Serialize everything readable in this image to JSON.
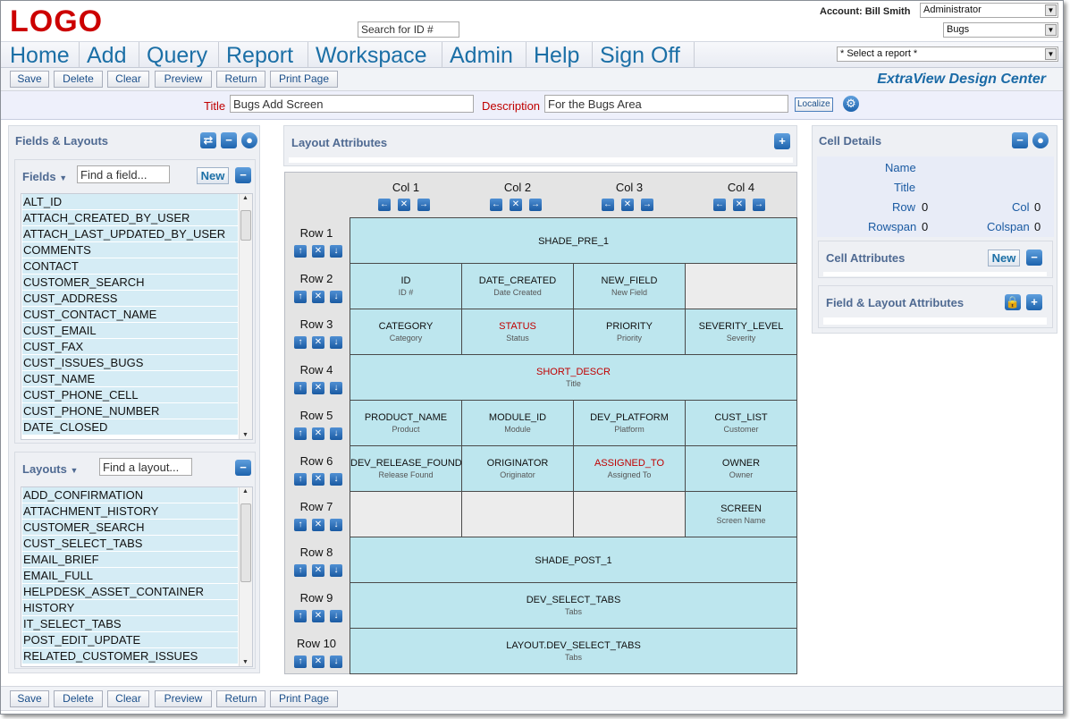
{
  "header": {
    "logo": "LOGO",
    "search_placeholder": "Search for ID #",
    "account_label": "Account: Bill Smith",
    "role_select": "Administrator",
    "area_select": "Bugs",
    "report_select": "* Select a report *"
  },
  "nav": [
    "Home",
    "Add",
    "Query",
    "Report",
    "Workspace",
    "Admin",
    "Help",
    "Sign Off"
  ],
  "toolbar": {
    "buttons": [
      "Save",
      "Delete",
      "Clear",
      "Preview",
      "Return",
      "Print Page"
    ],
    "design_center": "ExtraView Design Center"
  },
  "titlerow": {
    "title_label": "Title",
    "title_value": "Bugs Add Screen",
    "description_label": "Description",
    "description_value": "For the Bugs Area",
    "localize_label": "Localize"
  },
  "fields_layouts": {
    "title": "Fields & Layouts",
    "fields_label": "Fields",
    "fields_search_placeholder": "Find a field...",
    "new_label": "New",
    "fields": [
      "ALT_ID",
      "ATTACH_CREATED_BY_USER",
      "ATTACH_LAST_UPDATED_BY_USER",
      "COMMENTS",
      "CONTACT",
      "CUSTOMER_SEARCH",
      "CUST_ADDRESS",
      "CUST_CONTACT_NAME",
      "CUST_EMAIL",
      "CUST_FAX",
      "CUST_ISSUES_BUGS",
      "CUST_NAME",
      "CUST_PHONE_CELL",
      "CUST_PHONE_NUMBER",
      "DATE_CLOSED"
    ],
    "layouts_label": "Layouts",
    "layouts_search_placeholder": "Find a layout...",
    "layouts": [
      "ADD_CONFIRMATION",
      "ATTACHMENT_HISTORY",
      "CUSTOMER_SEARCH",
      "CUST_SELECT_TABS",
      "EMAIL_BRIEF",
      "EMAIL_FULL",
      "HELPDESK_ASSET_CONTAINER",
      "HISTORY",
      "IT_SELECT_TABS",
      "POST_EDIT_UPDATE",
      "RELATED_CUSTOMER_ISSUES"
    ]
  },
  "layout_attributes": {
    "title": "Layout Attributes",
    "columns": [
      "Col 1",
      "Col 2",
      "Col 3",
      "Col 4"
    ],
    "rows": [
      "Row 1",
      "Row 2",
      "Row 3",
      "Row 4",
      "Row 5",
      "Row 6",
      "Row 7",
      "Row 8",
      "Row 9",
      "Row 10"
    ]
  },
  "grid": {
    "r1": {
      "name": "SHADE_PRE_1",
      "title": ""
    },
    "r2c1": {
      "name": "ID",
      "title": "ID #"
    },
    "r2c2": {
      "name": "DATE_CREATED",
      "title": "Date Created"
    },
    "r2c3": {
      "name": "NEW_FIELD",
      "title": "New Field"
    },
    "r3c1": {
      "name": "CATEGORY",
      "title": "Category"
    },
    "r3c2": {
      "name": "STATUS",
      "title": "Status"
    },
    "r3c3": {
      "name": "PRIORITY",
      "title": "Priority"
    },
    "r3c4": {
      "name": "SEVERITY_LEVEL",
      "title": "Severity"
    },
    "r4": {
      "name": "SHORT_DESCR",
      "title": "Title"
    },
    "r5c1": {
      "name": "PRODUCT_NAME",
      "title": "Product"
    },
    "r5c2": {
      "name": "MODULE_ID",
      "title": "Module"
    },
    "r5c3": {
      "name": "DEV_PLATFORM",
      "title": "Platform"
    },
    "r5c4": {
      "name": "CUST_LIST",
      "title": "Customer"
    },
    "r6c1": {
      "name": "DEV_RELEASE_FOUND",
      "title": "Release Found"
    },
    "r6c2": {
      "name": "ORIGINATOR",
      "title": "Originator"
    },
    "r6c3": {
      "name": "ASSIGNED_TO",
      "title": "Assigned To"
    },
    "r6c4": {
      "name": "OWNER",
      "title": "Owner"
    },
    "r7c4": {
      "name": "SCREEN",
      "title": "Screen Name"
    },
    "r8": {
      "name": "SHADE_POST_1",
      "title": ""
    },
    "r9": {
      "name": "DEV_SELECT_TABS",
      "title": "Tabs"
    },
    "r10": {
      "name": "LAYOUT.DEV_SELECT_TABS",
      "title": "Tabs"
    }
  },
  "cell_details": {
    "title": "Cell Details",
    "name_label": "Name",
    "title_label": "Title",
    "row_label": "Row",
    "row_value": "0",
    "col_label": "Col",
    "col_value": "0",
    "rowspan_label": "Rowspan",
    "rowspan_value": "0",
    "colspan_label": "Colspan",
    "colspan_value": "0"
  },
  "cell_attributes": {
    "title": "Cell Attributes",
    "new_label": "New"
  },
  "field_layout_attributes": {
    "title": "Field & Layout Attributes"
  },
  "colors": {
    "accent": "#1b6fa6",
    "logo": "#cc0000",
    "required": "#c00000",
    "cell": "#bde6ee"
  }
}
